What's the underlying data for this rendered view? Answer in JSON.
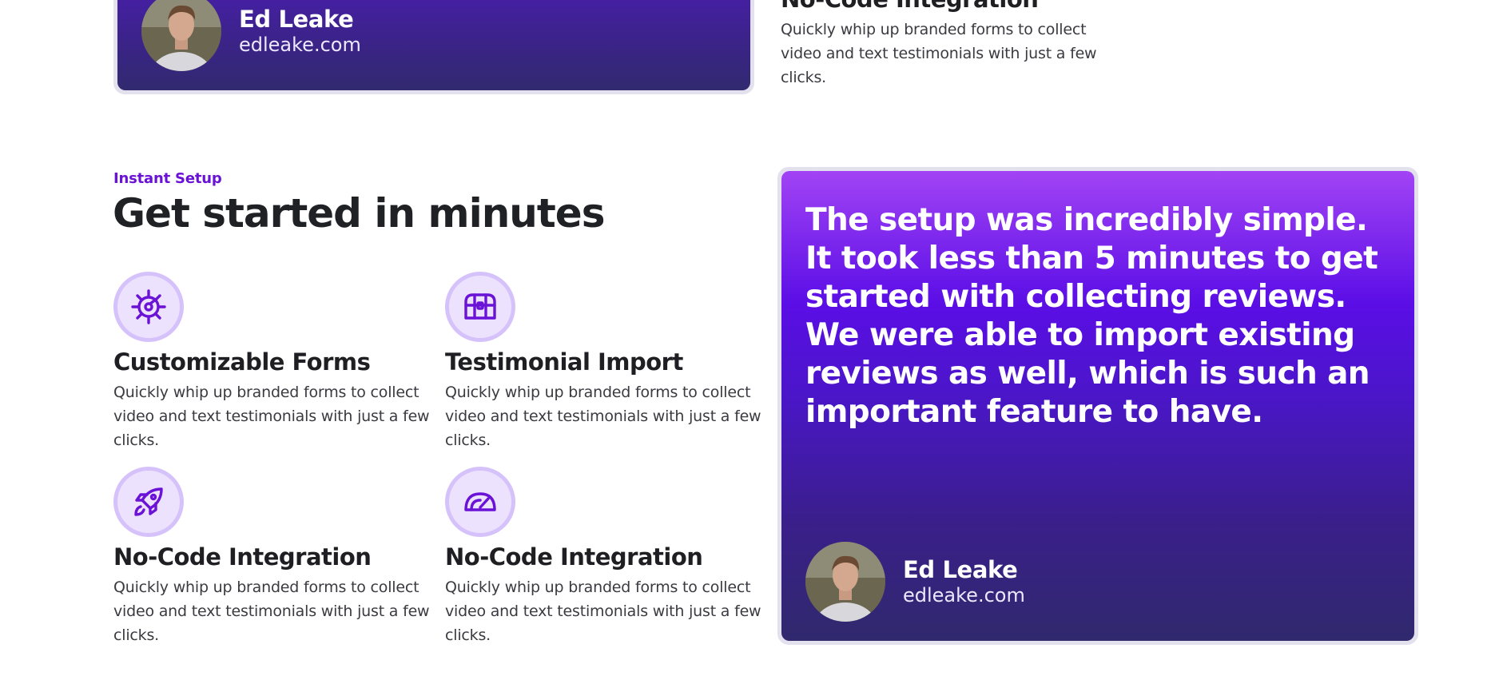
{
  "top_testimonial": {
    "author_name": "Ed Leake",
    "author_site": "edleake.com"
  },
  "top_feature": {
    "title": "No-Code Integration",
    "description": "Quickly whip up branded forms to collect video and text testimonials with just a few clicks."
  },
  "section": {
    "eyebrow": "Instant Setup",
    "heading": "Get started in minutes"
  },
  "features": [
    {
      "icon": "gear-icon",
      "title": "Customizable Forms",
      "description": "Quickly whip up branded forms to collect video and text testimonials with just a few clicks."
    },
    {
      "icon": "treasure-chest-icon",
      "title": "Testimonial Import",
      "description": "Quickly whip up branded forms to collect video and text testimonials with just a few clicks."
    },
    {
      "icon": "rocket-icon",
      "title": "No-Code Integration",
      "description": "Quickly whip up branded forms to collect video and text testimonials with just a few clicks."
    },
    {
      "icon": "speedometer-icon",
      "title": "No-Code Integration",
      "description": "Quickly whip up branded forms to collect video and text testimonials with just a few clicks."
    }
  ],
  "testimonial": {
    "quote": "The setup was incredibly simple. It took less than 5 minutes to get started with collecting reviews. We were able to import existing reviews as well, which is such an important feature to have.",
    "author_name": "Ed Leake",
    "author_site": "edleake.com"
  },
  "colors": {
    "accent": "#6a12d6",
    "icon_bg": "#ece2fd",
    "icon_ring": "#d6c2fb",
    "card_top": "#a244f5",
    "card_mid": "#5b0ee6",
    "card_bottom": "#30296d"
  }
}
